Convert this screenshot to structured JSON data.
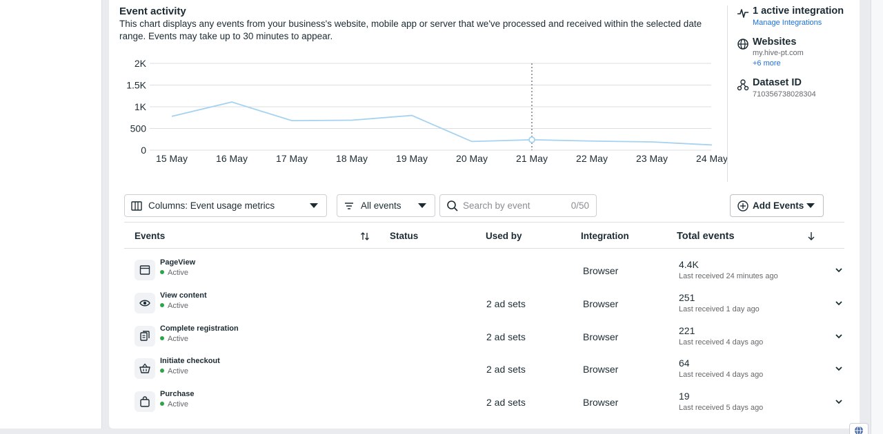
{
  "header": {
    "title": "Event activity",
    "description": "This chart displays any events from your business's website, mobile app or server that we've processed and received within the selected date range. Events may take up to 30 minutes to appear."
  },
  "chart_data": {
    "type": "line",
    "categories": [
      "15 May",
      "16 May",
      "17 May",
      "18 May",
      "19 May",
      "20 May",
      "21 May",
      "22 May",
      "23 May",
      "24 May"
    ],
    "series": [
      {
        "values": [
          780,
          1110,
          680,
          690,
          800,
          200,
          240,
          210,
          190,
          120
        ]
      }
    ],
    "y_ticks": [
      "2K",
      "1.5K",
      "1K",
      "500",
      "0"
    ],
    "ylim": [
      0,
      2000
    ],
    "grid": true,
    "highlight_category": "21 May",
    "line_color": "#a4d2f0"
  },
  "sidebar": {
    "integration_title": "1 active integration",
    "manage_link": "Manage Integrations",
    "websites_title": "Websites",
    "website_url": "my.hive-pt.com",
    "more_link": "+6 more",
    "dataset_title": "Dataset ID",
    "dataset_id": "710356738028304"
  },
  "controls": {
    "columns_label": "Columns: Event usage metrics",
    "filter_label": "All events",
    "search_placeholder": "Search by event",
    "search_count": "0/50",
    "add_events_label": "Add Events"
  },
  "table": {
    "headers": {
      "events": "Events",
      "status": "Status",
      "used_by": "Used by",
      "integration": "Integration",
      "total": "Total events"
    },
    "rows": [
      {
        "name": "PageView",
        "status": "Active",
        "used_by": "",
        "integration": "Browser",
        "total": "4.4K",
        "last": "Last received 24 minutes ago",
        "icon": "page-icon"
      },
      {
        "name": "View content",
        "status": "Active",
        "used_by": "2 ad sets",
        "integration": "Browser",
        "total": "251",
        "last": "Last received 1 day ago",
        "icon": "eye-icon"
      },
      {
        "name": "Complete registration",
        "status": "Active",
        "used_by": "2 ad sets",
        "integration": "Browser",
        "total": "221",
        "last": "Last received 4 days ago",
        "icon": "registration-icon"
      },
      {
        "name": "Initiate checkout",
        "status": "Active",
        "used_by": "2 ad sets",
        "integration": "Browser",
        "total": "64",
        "last": "Last received 4 days ago",
        "icon": "basket-icon"
      },
      {
        "name": "Purchase",
        "status": "Active",
        "used_by": "2 ad sets",
        "integration": "Browser",
        "total": "19",
        "last": "Last received 5 days ago",
        "icon": "shopping-bag-icon"
      }
    ]
  },
  "colors": {
    "accent": "#1a6ed8",
    "active_dot": "#31a24c"
  }
}
